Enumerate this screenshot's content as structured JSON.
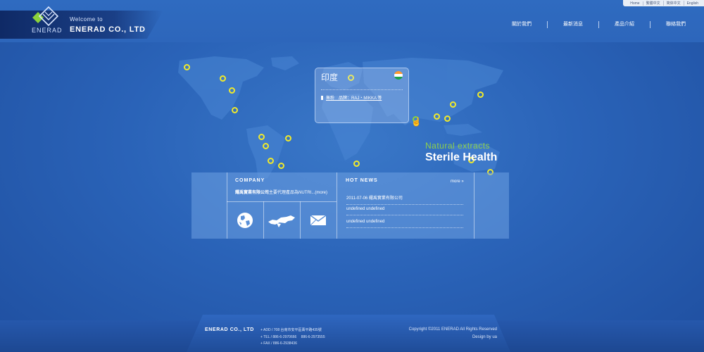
{
  "toplinks": [
    "Home",
    "繁體中文",
    "简体中文",
    "English"
  ],
  "header": {
    "logo_text": "ENERAD",
    "welcome": "Welcome to",
    "company": "ENERAD CO., LTD"
  },
  "nav": [
    "關於我們",
    "最新消息",
    "產品介紹",
    "聯絡我們"
  ],
  "popup": {
    "country": "印度",
    "item": "無粉　品牌：RAJ・MIKKA 等"
  },
  "tagline": {
    "line1": "Natural extracts",
    "line2": "Sterile Health"
  },
  "company_section": {
    "title": "COMPANY",
    "name": "耀禹實業有限公司",
    "desc": "主要代理產品為NUTRI...(more)"
  },
  "news_section": {
    "title": "HOT NEWS",
    "more": "more »",
    "items": [
      {
        "date": "2011-07-06",
        "title": "耀禹實業有限公司"
      },
      {
        "date": "",
        "title": "undefined undefined"
      },
      {
        "date": "",
        "title": "undefined undefined"
      }
    ]
  },
  "icons": [
    "globe-icon",
    "map-icon",
    "mail-icon"
  ],
  "footer": {
    "company": "ENERAD CO., LTD",
    "add": "+ ADD / 708 台南市安平區菁平路435號",
    "tel": "+ TEL / 886-6-2970666　 886-6-2973555",
    "fax": "+ FAX / 886-6-2938436",
    "copyright": "Copyright ©2011 ENERAD All Rights Reserved",
    "design": "Design by ",
    "design_by": "ua"
  },
  "colors": {
    "marker": "#f1ea2a",
    "marker_active": "#8bd23b",
    "accent_green": "#8ed14a"
  }
}
